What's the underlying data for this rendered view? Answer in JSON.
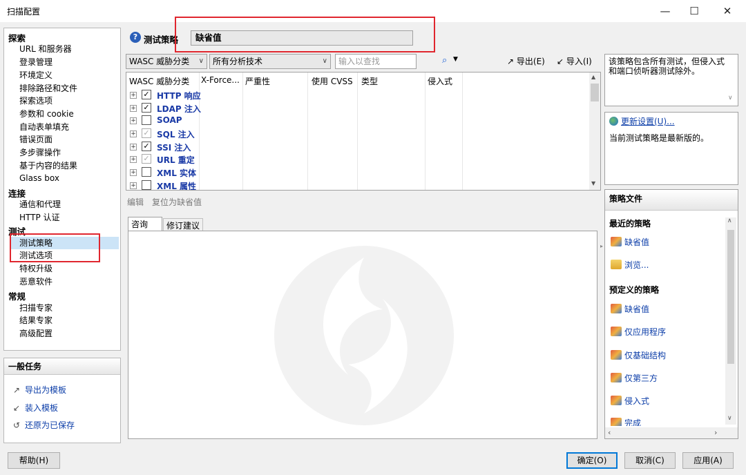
{
  "window": {
    "title": "扫描配置",
    "minimize": "—",
    "maximize": "☐",
    "close": "✕"
  },
  "nav": {
    "sections": [
      {
        "title": "探索",
        "items": [
          "URL 和服务器",
          "登录管理",
          "环境定义",
          "排除路径和文件",
          "探索选项",
          "参数和 cookie",
          "自动表单填充",
          "错误页面",
          "多步骤操作",
          "基于内容的结果",
          "Glass box"
        ]
      },
      {
        "title": "连接",
        "items": [
          "通信和代理",
          "HTTP 认证"
        ]
      },
      {
        "title": "测试",
        "items": [
          "测试策略",
          "测试选项",
          "特权升级",
          "恶意软件"
        ]
      },
      {
        "title": "常规",
        "items": [
          "扫描专家",
          "结果专家",
          "高级配置"
        ]
      }
    ],
    "selected": "测试策略"
  },
  "tasks": {
    "title": "一般任务",
    "items": [
      "导出为模板",
      "装入模板",
      "还原为已保存"
    ]
  },
  "buttons": {
    "help": "帮助(H)",
    "ok": "确定(O)",
    "cancel": "取消(C)",
    "apply": "应用(A)"
  },
  "policy": {
    "label": "测试策略",
    "value": "缺省值"
  },
  "filters": {
    "category": "WASC 威胁分类",
    "technique": "所有分析技术",
    "search_placeholder": "输入以查找",
    "export": "导出(E)",
    "import": "导入(I)"
  },
  "grid": {
    "columns": [
      "WASC 威胁分类",
      "X-Force...",
      "严重性",
      "使用 CVSS",
      "类型",
      "侵入式"
    ],
    "rows": [
      {
        "label": "HTTP 响应",
        "check": "checked"
      },
      {
        "label": "LDAP 注入",
        "check": "checked"
      },
      {
        "label": "SOAP",
        "check": "unchecked"
      },
      {
        "label": "SQL 注入",
        "check": "partial"
      },
      {
        "label": "SSI 注入",
        "check": "checked"
      },
      {
        "label": "URL 重定",
        "check": "partial"
      },
      {
        "label": "XML 实体",
        "check": "unchecked"
      },
      {
        "label": "XML 属性",
        "check": "unchecked"
      }
    ]
  },
  "actions": {
    "edit": "编辑",
    "reset": "复位为缺省值"
  },
  "tabs": [
    "咨询",
    "修订建议"
  ],
  "description": "该策略包含所有测试，但侵入式和端口侦听器测试除外。",
  "update": {
    "link": "更新设置(U)...",
    "status": "当前测试策略是最新版的。"
  },
  "policy_files": {
    "title": "策略文件",
    "recent_title": "最近的策略",
    "recent": [
      "缺省值",
      "浏览..."
    ],
    "predefined_title": "预定义的策略",
    "predefined": [
      "缺省值",
      "仅应用程序",
      "仅基础结构",
      "仅第三方",
      "侵入式",
      "完成"
    ]
  },
  "icons": [
    "help-icon",
    "search-icon",
    "export-icon",
    "import-icon",
    "update-icon",
    "policy-icon",
    "browse-icon",
    "app-logo-watermark"
  ],
  "colors": {
    "selection": "#cce4f7",
    "link": "#0b3da8",
    "annotation_red": "#e0262e"
  }
}
